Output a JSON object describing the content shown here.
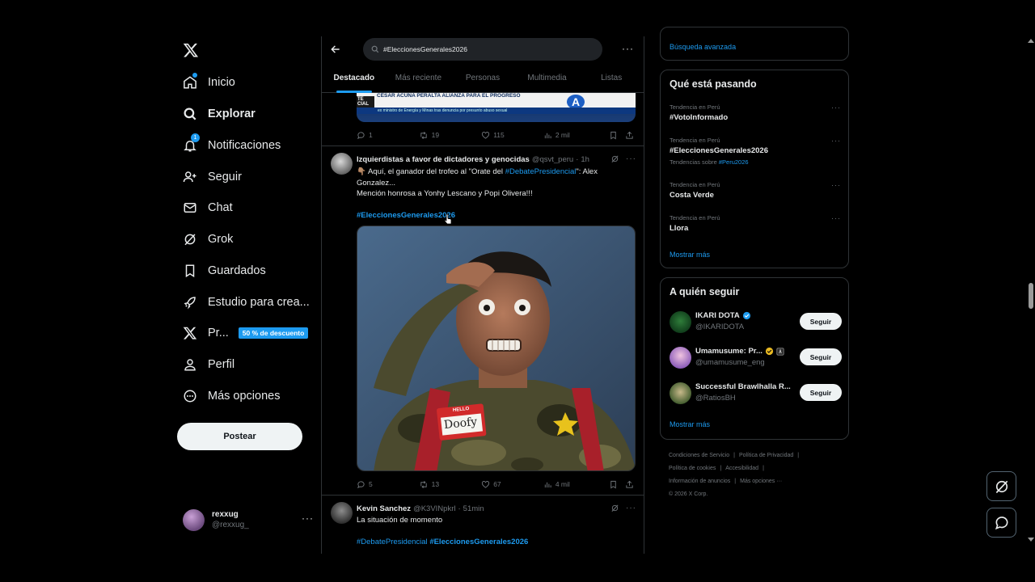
{
  "nav": {
    "items": [
      {
        "label": "Inicio",
        "icon": "home-icon"
      },
      {
        "label": "Explorar",
        "icon": "search-icon"
      },
      {
        "label": "Notificaciones",
        "icon": "bell-icon",
        "badge": "1"
      },
      {
        "label": "Seguir",
        "icon": "person-add-icon"
      },
      {
        "label": "Chat",
        "icon": "mail-icon"
      },
      {
        "label": "Grok",
        "icon": "grok-icon"
      },
      {
        "label": "Guardados",
        "icon": "bookmark-icon"
      },
      {
        "label": "Estudio para crea...",
        "icon": "rocket-icon"
      },
      {
        "label": "Pr...",
        "icon": "x-premium-icon",
        "promo": "50 % de descuento"
      },
      {
        "label": "Perfil",
        "icon": "person-icon"
      },
      {
        "label": "Más opciones",
        "icon": "more-circle-icon"
      }
    ],
    "post_label": "Postear"
  },
  "account": {
    "name": "rexxug",
    "handle": "@rexxug_"
  },
  "search": {
    "value": "#EleccionesGenerales2026"
  },
  "tabs": [
    "Destacado",
    "Más reciente",
    "Personas",
    "Multimedia",
    "Listas"
  ],
  "prev_tweet": {
    "media_headline": "CÉSAR ACUÑA PERALTA ALIANZA PARA EL PROGRESO",
    "media_ticker": "ex ministro de Energía y Minas tras denuncia por presunto abuso sexual",
    "replies": "1",
    "reposts": "19",
    "likes": "115",
    "views": "2 mil"
  },
  "tweet1": {
    "name": "Izquierdistas a favor de dictadores y genocidas",
    "handle": "@qsvt_peru",
    "time": "1h",
    "line1_pre": "👇🏽 Aquí, el ganador del trofeo al \"Orate del ",
    "line1_link": "#DebatePresidencial",
    "line1_post": "\": Alex Gonzalez...",
    "line2": "Mención honrosa a Yonhy Lescano y Popi Olivera!!!",
    "hashtag": "#EleccionesGenerales2026",
    "media_name_tag_top": "HELLO",
    "media_name_tag": "Doofy",
    "replies": "5",
    "reposts": "13",
    "likes": "67",
    "views": "4 mil"
  },
  "tweet2": {
    "name": "Kevin Sanchez",
    "handle": "@K3VINpkrl",
    "time": "51min",
    "text": "La situación de momento",
    "tag1": "#DebatePresidencial",
    "tag2": "#EleccionesGenerales2026"
  },
  "right": {
    "advanced_search": "Búsqueda avanzada",
    "trends_title": "Qué está pasando",
    "trends": [
      {
        "context": "Tendencia en Perú",
        "name": "#VotoInformado"
      },
      {
        "context": "Tendencia en Perú",
        "name": "#EleccionesGenerales2026",
        "sub_pre": "Tendencias sobre ",
        "sub_link": "#Peru2026"
      },
      {
        "context": "Tendencia en Perú",
        "name": "Costa Verde"
      },
      {
        "context": "Tendencia en Perú",
        "name": "Llora"
      }
    ],
    "show_more": "Mostrar más",
    "who_title": "A quién seguir",
    "follow": [
      {
        "name": "IKARI DOTA",
        "handle": "@IKARIDOTA",
        "button": "Seguir"
      },
      {
        "name": "Umamusume: Pr...",
        "handle": "@umamusume_eng",
        "button": "Seguir"
      },
      {
        "name": "Successful Brawlhalla R...",
        "handle": "@RatiosBH",
        "button": "Seguir"
      }
    ],
    "show_more2": "Mostrar más",
    "footer": {
      "terms": "Condiciones de Servicio",
      "privacy": "Política de Privacidad",
      "cookies": "Política de cookies",
      "accessibility": "Accesibilidad",
      "ads": "Información de anuncios",
      "more": "Más opciones ···",
      "copyright": "© 2026 X Corp."
    }
  },
  "colors": {
    "accent": "#1d9bf0",
    "bg": "#000000",
    "text": "#e7e9ea",
    "muted": "#71767b",
    "border": "#2f3336"
  }
}
